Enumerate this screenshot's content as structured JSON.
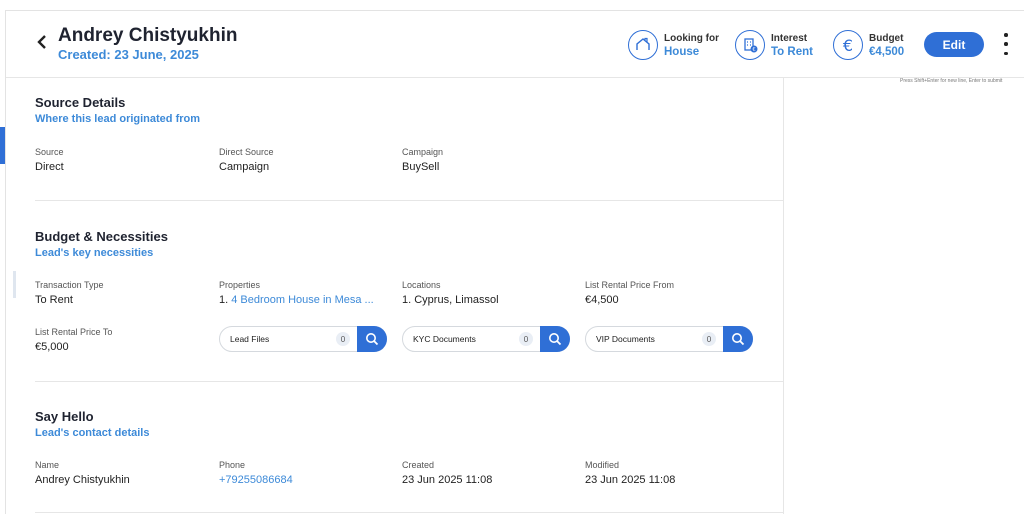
{
  "header": {
    "back_icon": "chevron-left-icon",
    "name": "Andrey Chistyukhin",
    "created": "Created: 23 June, 2025",
    "stats": [
      {
        "icon": "house-icon",
        "label": "Looking for",
        "value": "House"
      },
      {
        "icon": "building-euro-icon",
        "label": "Interest",
        "value": "To Rent"
      },
      {
        "icon": "euro-icon",
        "label": "Budget",
        "value": "€4,500"
      }
    ],
    "edit_label": "Edit",
    "more_icon": "kebab-icon"
  },
  "hint": "Press Shift+Enter for new line, Enter to submit",
  "source": {
    "title": "Source Details",
    "subtitle": "Where this lead originated from",
    "fields": [
      {
        "label": "Source",
        "value": "Direct"
      },
      {
        "label": "Direct Source",
        "value": "Campaign"
      },
      {
        "label": "Campaign",
        "value": "BuySell"
      }
    ]
  },
  "budget": {
    "title": "Budget & Necessities",
    "subtitle": "Lead's key necessities",
    "fields": [
      {
        "label": "Transaction Type",
        "value": "To Rent"
      },
      {
        "label": "Properties",
        "prefix": "1.",
        "value": "4 Bedroom House in Mesa ..."
      },
      {
        "label": "Locations",
        "value": "1. Cyprus, Limassol"
      },
      {
        "label": "List Rental Price From",
        "value": "€4,500"
      },
      {
        "label": "List Rental Price To",
        "value": "€5,000"
      }
    ],
    "docs": [
      {
        "label": "Lead Files",
        "count": "0"
      },
      {
        "label": "KYC Documents",
        "count": "0"
      },
      {
        "label": "VIP Documents",
        "count": "0"
      }
    ]
  },
  "hello": {
    "title": "Say Hello",
    "subtitle": "Lead's contact details",
    "fields": [
      {
        "label": "Name",
        "value": "Andrey Chistyukhin"
      },
      {
        "label": "Phone",
        "value": "+79255086684"
      },
      {
        "label": "Created",
        "value": "23 Jun 2025 11:08"
      },
      {
        "label": "Modified",
        "value": "23 Jun 2025 11:08"
      }
    ]
  }
}
